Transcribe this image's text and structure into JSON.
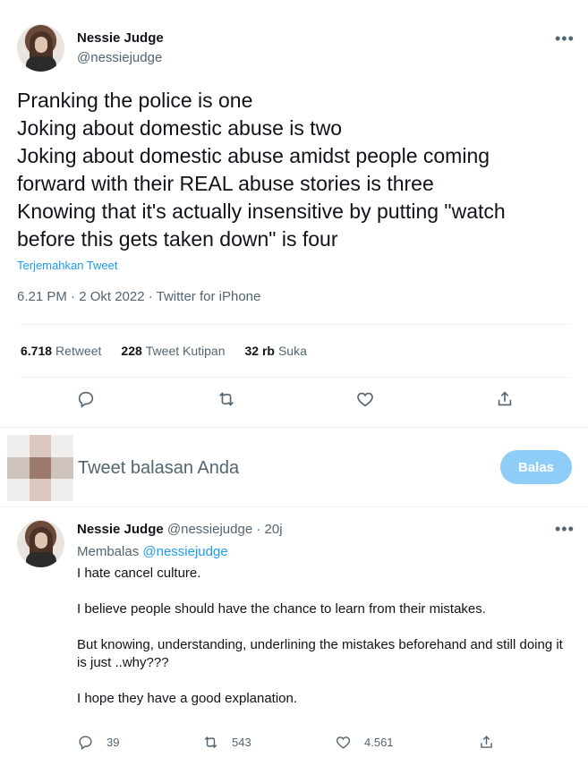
{
  "main_tweet": {
    "author_name": "Nessie Judge",
    "author_handle": "@nessiejudge",
    "text_lines": [
      "Pranking the police is one",
      "Joking about domestic abuse is two",
      "Joking about domestic abuse amidst people coming",
      "forward with their REAL abuse stories is three",
      "Knowing that it's actually insensitive by putting \"watch",
      "before this gets taken down\" is four"
    ],
    "translate_label": "Terjemahkan Tweet",
    "meta": "6.21 PM · 2 Okt 2022 · Twitter for iPhone",
    "more_glyph": "•••",
    "stats": {
      "retweets_count": "6.718",
      "retweets_label": "Retweet",
      "quotes_count": "228",
      "quotes_label": "Tweet Kutipan",
      "likes_count": "32 rb",
      "likes_label": "Suka"
    },
    "actions": [
      "reply-icon",
      "retweet-icon",
      "like-icon",
      "share-icon"
    ]
  },
  "reply_box": {
    "placeholder": "Tweet balasan Anda",
    "button_label": "Balas",
    "button_color": "#8ecdf7"
  },
  "reply_tweet": {
    "author_name": "Nessie Judge",
    "author_handle": "@nessiejudge",
    "separator": "·",
    "time": "20j",
    "more_glyph": "•••",
    "replying_prefix": "Membalas",
    "replying_to": "@nessiejudge",
    "paragraphs": [
      "I hate cancel culture.",
      "I believe people should have the chance to learn from their mistakes.",
      "But knowing, understanding, underlining the mistakes beforehand and still doing it is just ..why???",
      "I hope they have a good explanation."
    ],
    "reply_count": "39",
    "retweet_count": "543",
    "like_count": "4.561"
  },
  "colors": {
    "text": "#0f1419",
    "secondary": "#536471",
    "accent": "#1d9bf0",
    "divider": "#eff3f4"
  }
}
